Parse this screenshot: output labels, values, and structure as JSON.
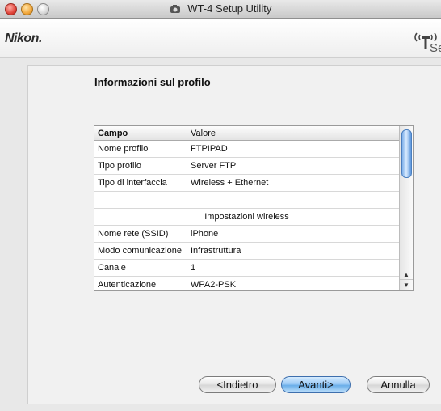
{
  "window": {
    "title": "WT-4 Setup Utility"
  },
  "header": {
    "brand": "Nikon.",
    "setup_logo_text": "Setup"
  },
  "main": {
    "section_title": "Informazioni sul profilo",
    "table": {
      "columns": [
        "Campo",
        "Valore"
      ],
      "rows": [
        {
          "field": "Nome profilo",
          "value": "FTPIPAD"
        },
        {
          "field": "Tipo profilo",
          "value": "Server FTP"
        },
        {
          "field": "Tipo di interfaccia",
          "value": "Wireless + Ethernet"
        },
        {
          "field": "",
          "value": ""
        },
        {
          "section": "Impostazioni wireless"
        },
        {
          "field": "Nome rete (SSID)",
          "value": "iPhone"
        },
        {
          "field": "Modo comunicazione",
          "value": "Infrastruttura"
        },
        {
          "field": "Canale",
          "value": "1"
        },
        {
          "field": "Autenticazione",
          "value": "WPA2-PSK"
        }
      ]
    }
  },
  "buttons": {
    "back": "<Indietro",
    "next": "Avanti>",
    "cancel": "Annulla"
  },
  "icons": {
    "app_icon": "camera-wireless-icon",
    "scroll_up": "arrow-up-icon",
    "scroll_down": "arrow-down-icon"
  },
  "colors": {
    "accent": "#6aaee9"
  }
}
